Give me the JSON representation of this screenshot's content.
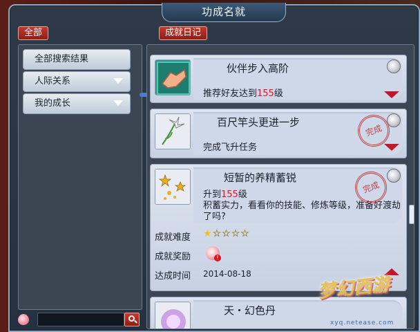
{
  "window": {
    "title": "功成名就"
  },
  "header": {
    "all_label": "全部",
    "diary_label": "成就日记"
  },
  "sidebar": {
    "items": [
      {
        "label": "全部搜索结果",
        "has_arrow": false
      },
      {
        "label": "人际关系",
        "has_arrow": true
      },
      {
        "label": "我的成长",
        "has_arrow": true
      }
    ]
  },
  "search": {
    "value": ""
  },
  "entries": [
    {
      "title": "伙伴步入高阶",
      "desc_prefix": "推荐好友达到",
      "desc_num": "155",
      "desc_suffix": "级",
      "completed": false
    },
    {
      "title": "百尺竿头更进一步",
      "desc": "完成飞升任务",
      "completed": true,
      "stamp": "完成"
    },
    {
      "title": "短暂的养精蓄锐",
      "desc_prefix": "升到",
      "desc_num": "155",
      "desc_suffix": "级",
      "desc2": "积蓄实力，看看你的技能、修炼等级，准备好渡劫了吗?",
      "completed": true,
      "stamp": "完成",
      "difficulty_label": "成就难度",
      "difficulty_filled": 1,
      "difficulty_total": 5,
      "reward_label": "成就奖励",
      "reward_badge": "!",
      "time_label": "达成时间",
      "time_value": "2014-08-18"
    },
    {
      "title": "天・幻色丹"
    }
  ],
  "watermark": {
    "main": "梦幻西游",
    "sub": "xyq.netease.com"
  },
  "colors": {
    "accent_red": "#c01828",
    "highlight_num": "#e0182a",
    "star": "#f0c020"
  }
}
